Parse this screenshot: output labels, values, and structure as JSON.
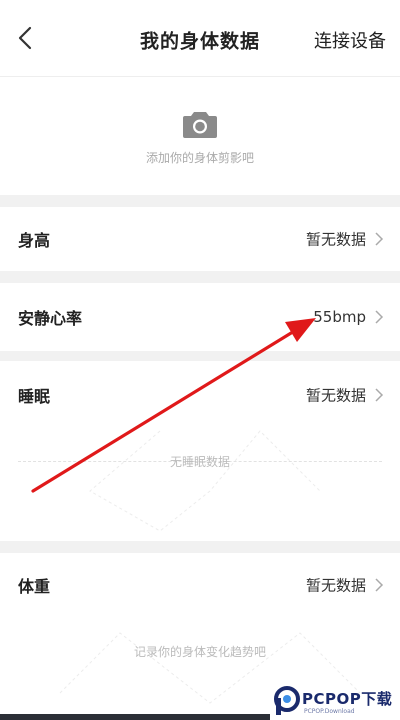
{
  "header": {
    "title": "我的身体数据",
    "connect_label": "连接设备",
    "back_icon": "chevron-left-icon"
  },
  "photo": {
    "icon": "camera-icon",
    "hint": "添加你的身体剪影吧"
  },
  "rows": [
    {
      "label": "身高",
      "value": "暂无数据"
    },
    {
      "label": "安静心率",
      "value": "55bmp"
    },
    {
      "label": "睡眠",
      "value": "暂无数据"
    },
    {
      "label": "体重",
      "value": "暂无数据"
    }
  ],
  "sleep_empty": "无睡眠数据",
  "weight_empty": "记录你的身体变化趋势吧",
  "watermark": {
    "brand": "PCPOP下载",
    "subtext": "PCPOP.Download",
    "color": "#1a2a6c"
  },
  "colors": {
    "annotation_arrow": "#e0191a",
    "section_gap": "#f1f1f1",
    "muted_text": "#aaaaaa"
  }
}
